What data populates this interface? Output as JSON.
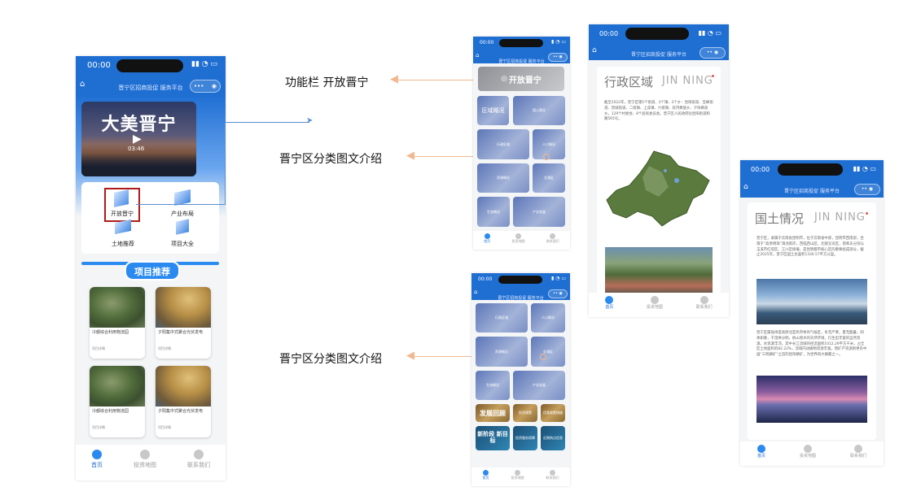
{
  "status": {
    "time": "00:00"
  },
  "navbar": {
    "title": "晋宁区招商投促 服务平台",
    "more": "•••"
  },
  "tabs": [
    "首页",
    "投资地图",
    "联系我们"
  ],
  "main_phone": {
    "banner": {
      "title": "大美晋宁",
      "duration": "03:46"
    },
    "menu": [
      "开放晋宁",
      "产业布局",
      "土地推荐",
      "项目大全"
    ],
    "section_title": "项目推荐",
    "projects": [
      {
        "name": "冷都综合利用物流园",
        "meta": "项目详情"
      },
      {
        "name": "夕阳集中式聚合光伏发电",
        "meta": "项目详情"
      },
      {
        "name": "冷都综合利用物流园",
        "meta": "项目详情"
      },
      {
        "name": "夕阳集中式聚合光伏发电",
        "meta": "项目详情"
      }
    ]
  },
  "annotations": {
    "a1": "功能栏 开放晋宁",
    "a2": "晋宁区分类图文介绍",
    "a3": "晋宁区分类图文介绍"
  },
  "phone2": {
    "header_btn": "开放晋宁",
    "tiles": [
      "区域概况",
      "国土情况",
      "行政区域",
      "人口情况",
      "资源概况",
      "交通区",
      "生态概况",
      "产业发展"
    ]
  },
  "phone3": {
    "tiles": [
      "行政区域",
      "人口情况",
      "资源概况",
      "交通区",
      "生态概况",
      "产业发展"
    ],
    "promo": [
      "发展回顾",
      "投资政策",
      "优惠政策措施",
      "新阶段 新目标",
      "投资服务保障",
      "近期热点信息"
    ]
  },
  "phone4": {
    "heading": "行政区域",
    "heading_en": "JIN NING",
    "paragraph": "截至2022年，晋宁区辖5个街道、3个镇、2个乡：昆阳街道、宝峰街道、晋城街道、二街镇、上蒜镇、六街镇、双河彝族乡、夕阳彝族乡。129个村委会、8个居民委员会。晋宁区人民政府驻昆阳街道和路565号。"
  },
  "phone5": {
    "heading": "国土情况",
    "heading_en": "JIN NING",
    "paragraph1": "晋宁区，隶属于云南省昆明市，位于云南省中部，昆明市西南部，坐落于“高原明珠”滇池南岸，西临西山区，北接呈贡区，南和东分别与玉溪市红塔区、江川区接壤，是昆明都市核心区的重要组成部分。截止2025年，晋宁区国土总面积1336.57平方公里。",
    "paragraph2": "晋宁区属低纬度高原北亚热带季风气候区，冬无严寒，夏无酷暑，四季如春，干湿季分明，依山傍水的天然环境，衍生出丰富的自然资源。水资源丰沛，其中长江流域的径流面积1012.29平方千米，占全区土地面积的82.22%，流域内动植物资源丰富。而矿产资源则更有中国“三明磷矿”之首的昆阳磷矿，为世界四大磷都之一。"
  }
}
